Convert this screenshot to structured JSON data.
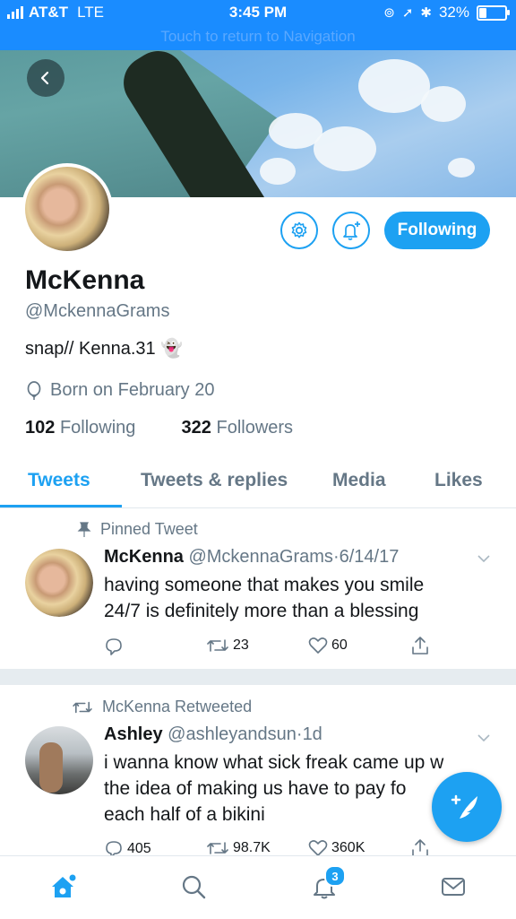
{
  "status_bar": {
    "carrier": "AT&T",
    "network": "LTE",
    "time": "3:45 PM",
    "battery": "32%",
    "battery_level": 0.32,
    "return_text": "Touch to return to Navigation"
  },
  "profile": {
    "name": "McKenna",
    "handle": "@MckennaGrams",
    "bio": "snap// Kenna.31 👻",
    "birthday": "Born on February 20",
    "following_count": "102",
    "following_label": "Following",
    "followers_count": "322",
    "followers_label": "Followers",
    "follow_button_label": "Following"
  },
  "tabs": [
    {
      "label": "Tweets",
      "active": true
    },
    {
      "label": "Tweets & replies",
      "active": false
    },
    {
      "label": "Media",
      "active": false
    },
    {
      "label": "Likes",
      "active": false
    }
  ],
  "tweets": [
    {
      "context": "Pinned Tweet",
      "author": "McKenna",
      "handle": "@MckennaGrams",
      "date": "6/14/17",
      "text_lines": [
        "having someone that makes you smile",
        "24/7 is definitely more than a blessing"
      ],
      "replies": "",
      "retweets": "23",
      "likes": "60"
    },
    {
      "context": "McKenna Retweeted",
      "author": "Ashley",
      "handle": "@ashleyandsun",
      "date": "1d",
      "text_lines": [
        "i wanna know what sick freak came up w",
        "the idea of making us have to pay fo",
        "each half of a bikini"
      ],
      "replies": "405",
      "retweets": "98.7K",
      "likes": "360K"
    }
  ],
  "bottom_nav": {
    "notifications_badge": "3"
  },
  "colors": {
    "accent": "#1da1f2",
    "status_bar": "#1a8cff",
    "muted": "#657786"
  }
}
